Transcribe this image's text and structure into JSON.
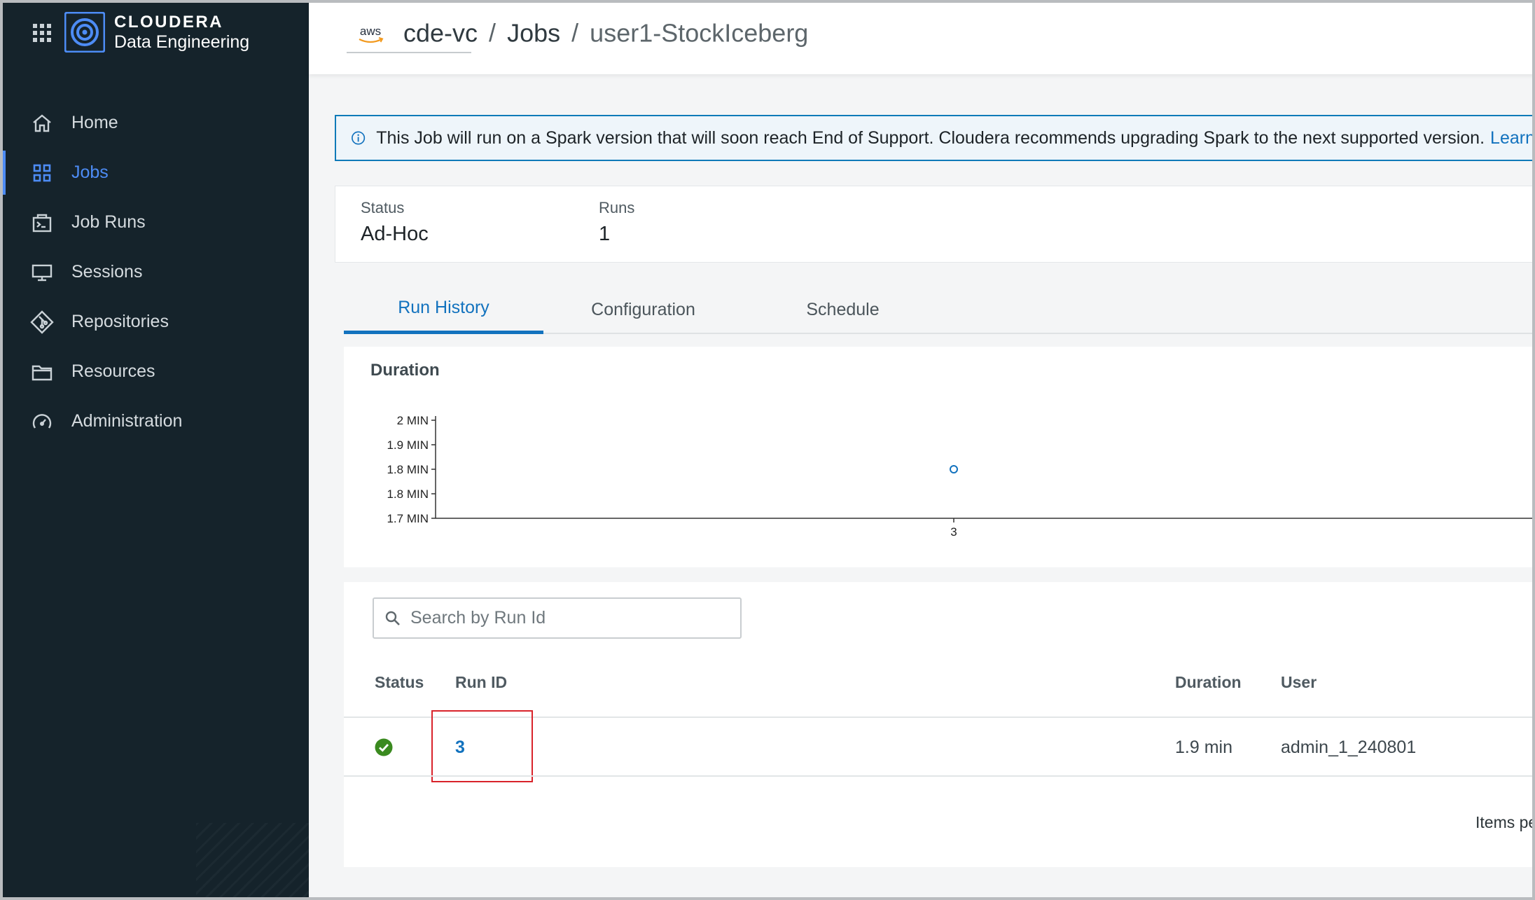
{
  "app": {
    "brand_name": "CLOUDERA",
    "product_name": "Data Engineering"
  },
  "sidebar": {
    "items": [
      {
        "label": "Home",
        "icon": "home-icon",
        "active": false
      },
      {
        "label": "Jobs",
        "icon": "jobs-grid-icon",
        "active": true
      },
      {
        "label": "Job Runs",
        "icon": "job-runs-icon",
        "active": false
      },
      {
        "label": "Sessions",
        "icon": "monitor-icon",
        "active": false
      },
      {
        "label": "Repositories",
        "icon": "git-icon",
        "active": false
      },
      {
        "label": "Resources",
        "icon": "folder-icon",
        "active": false
      },
      {
        "label": "Administration",
        "icon": "gauge-icon",
        "active": false
      }
    ]
  },
  "header": {
    "cloud_provider": "aws",
    "breadcrumb": {
      "cluster": "cde-vc",
      "separator": "/",
      "section": "Jobs",
      "current": "user1-StockIceberg"
    }
  },
  "banner": {
    "message": "This Job will run on a Spark version that will soon reach End of Support. Cloudera recommends upgrading Spark to the next supported version.",
    "link": "Learn"
  },
  "summary": {
    "status_label": "Status",
    "status_value": "Ad-Hoc",
    "runs_label": "Runs",
    "runs_value": "1"
  },
  "tabs": [
    {
      "label": "Run History",
      "active": true
    },
    {
      "label": "Configuration",
      "active": false
    },
    {
      "label": "Schedule",
      "active": false
    }
  ],
  "chart_data": {
    "type": "scatter",
    "title": "Duration",
    "y_ticks": [
      "2 MIN",
      "1.9 MIN",
      "1.8 MIN",
      "1.8 MIN",
      "1.7 MIN"
    ],
    "ylim": [
      1.7,
      2.0
    ],
    "x_ticks": [
      "3"
    ],
    "series": [
      {
        "x": [
          "3"
        ],
        "values": [
          1.85
        ]
      }
    ],
    "point_color": "#1272be",
    "grid": false
  },
  "table": {
    "search_placeholder": "Search by Run Id",
    "columns": [
      "Status",
      "Run ID",
      "Duration",
      "User"
    ],
    "rows": [
      {
        "status": "succeeded",
        "status_color": "#3a8a1f",
        "run_id": "3",
        "duration": "1.9 min",
        "user": "admin_1_240801"
      }
    ],
    "footer": "Items pe"
  },
  "colors": {
    "accent": "#1272be",
    "sidebar_bg": "#15232b",
    "sidebar_active": "#4d8cf5",
    "highlight": "#d9232b"
  }
}
